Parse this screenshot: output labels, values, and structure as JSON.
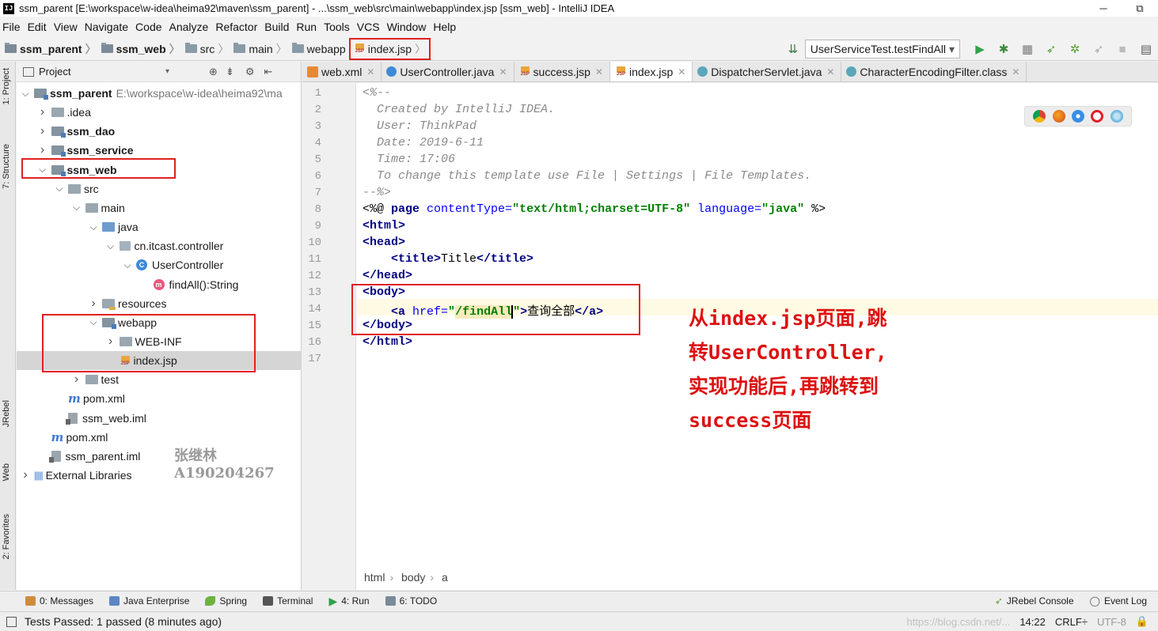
{
  "window": {
    "title": "ssm_parent [E:\\workspace\\w-idea\\heima92\\maven\\ssm_parent] - ...\\ssm_web\\src\\main\\webapp\\index.jsp [ssm_web] - IntelliJ IDEA",
    "app_icon": "IJ",
    "minimize": "─",
    "maximize": "⧉"
  },
  "menu": [
    "File",
    "Edit",
    "View",
    "Navigate",
    "Code",
    "Analyze",
    "Refactor",
    "Build",
    "Run",
    "Tools",
    "VCS",
    "Window",
    "Help"
  ],
  "nav_breadcrumb": [
    "ssm_parent",
    "ssm_web",
    "src",
    "main",
    "webapp",
    "index.jsp"
  ],
  "run_config": "UserServiceTest.testFindAll",
  "left_strip_tabs": [
    "1: Project",
    "7: Structure",
    "JRebel",
    "Web",
    "2: Favorites"
  ],
  "project_panel": {
    "title": "Project",
    "tree": [
      {
        "label": "ssm_parent",
        "extra": "E:\\workspace\\w-idea\\heima92\\ma",
        "depth": 0,
        "arrow": "v",
        "icon": "module-folder",
        "bold": true
      },
      {
        "label": ".idea",
        "depth": 1,
        "arrow": ">",
        "icon": "folder"
      },
      {
        "label": "ssm_dao",
        "depth": 1,
        "arrow": ">",
        "icon": "module-folder",
        "bold": true
      },
      {
        "label": "ssm_service",
        "depth": 1,
        "arrow": ">",
        "icon": "module-folder",
        "bold": true
      },
      {
        "label": "ssm_web",
        "depth": 1,
        "arrow": "v",
        "icon": "module-folder",
        "bold": true
      },
      {
        "label": "src",
        "depth": 2,
        "arrow": "v",
        "icon": "folder"
      },
      {
        "label": "main",
        "depth": 3,
        "arrow": "v",
        "icon": "folder"
      },
      {
        "label": "java",
        "depth": 4,
        "arrow": "v",
        "icon": "source-folder"
      },
      {
        "label": "cn.itcast.controller",
        "depth": 5,
        "arrow": "v",
        "icon": "package"
      },
      {
        "label": "UserController",
        "depth": 6,
        "arrow": "v",
        "icon": "class"
      },
      {
        "label": "findAll():String",
        "depth": 7,
        "arrow": "",
        "icon": "method"
      },
      {
        "label": "resources",
        "depth": 4,
        "arrow": ">",
        "icon": "resource-folder"
      },
      {
        "label": "webapp",
        "depth": 4,
        "arrow": "v",
        "icon": "web-folder"
      },
      {
        "label": "WEB-INF",
        "depth": 5,
        "arrow": ">",
        "icon": "folder"
      },
      {
        "label": "index.jsp",
        "depth": 5,
        "arrow": "",
        "icon": "jsp-file",
        "selected": true
      },
      {
        "label": "test",
        "depth": 3,
        "arrow": ">",
        "icon": "folder"
      },
      {
        "label": "pom.xml",
        "depth": 2,
        "arrow": "",
        "icon": "maven"
      },
      {
        "label": "ssm_web.iml",
        "depth": 2,
        "arrow": "",
        "icon": "iml-file"
      },
      {
        "label": "pom.xml",
        "depth": 1,
        "arrow": "",
        "icon": "maven"
      },
      {
        "label": "ssm_parent.iml",
        "depth": 1,
        "arrow": "",
        "icon": "iml-file"
      },
      {
        "label": "External Libraries",
        "depth": 0,
        "arrow": ">",
        "icon": "library"
      }
    ]
  },
  "watermark": {
    "line1": "张继林",
    "line2": "A190204267"
  },
  "editor_tabs": [
    {
      "label": "web.xml",
      "icon": "xml"
    },
    {
      "label": "UserController.java",
      "icon": "java"
    },
    {
      "label": "success.jsp",
      "icon": "jsp"
    },
    {
      "label": "index.jsp",
      "icon": "jsp",
      "active": true
    },
    {
      "label": "DispatcherServlet.java",
      "icon": "cls"
    },
    {
      "label": "CharacterEncodingFilter.class",
      "icon": "cls"
    }
  ],
  "code": {
    "line_numbers": [
      "1",
      "2",
      "3",
      "4",
      "5",
      "6",
      "7",
      "8",
      "9",
      "10",
      "11",
      "12",
      "13",
      "14",
      "15",
      "16",
      "17"
    ],
    "comment_lines": [
      "<%--",
      "  Created by IntelliJ IDEA.",
      "  User: ThinkPad",
      "  Date: 2019-6-11",
      "  Time: 17:06",
      "  To change this template use File | Settings | File Templates.",
      "--%>"
    ],
    "l8": {
      "open": "<%@ ",
      "kw": "page",
      "a1": " contentType=",
      "v1": "\"text/html;charset=UTF-8\"",
      "a2": " language=",
      "v2": "\"java\"",
      "close": " %>"
    },
    "l9": "<html>",
    "l10": "<head>",
    "l11": {
      "indent": "    ",
      "open": "<title>",
      "text": "Title",
      "close": "</title>"
    },
    "l12": "</head>",
    "l13": "<body>",
    "l14": {
      "indent": "    ",
      "open": "<a",
      "attr": " href=",
      "q1": "\"",
      "val": "/findAll",
      "q2": "\"",
      "gt": ">",
      "text": "查询全部",
      "close": "</a>"
    },
    "l15": "</body>",
    "l16": "</html>"
  },
  "annotation": [
    "从index.jsp页面,跳",
    "转UserController,",
    "实现功能后,再跳转到",
    "success页面"
  ],
  "editor_breadcrumb": [
    "html",
    "body",
    "a"
  ],
  "bottom_tools": [
    {
      "label": "0: Messages",
      "color": "#d08c3c"
    },
    {
      "label": "Java Enterprise",
      "color": "#5b87c5"
    },
    {
      "label": "Spring",
      "color": "#6db33f"
    },
    {
      "label": "Terminal",
      "color": "#555555"
    },
    {
      "label": "4: Run",
      "color": "#2fa24a"
    },
    {
      "label": "6: TODO",
      "color": "#7a8a99"
    }
  ],
  "bottom_right_tools": [
    "JRebel Console",
    "Event Log"
  ],
  "status": {
    "message": "Tests Passed: 1 passed (8 minutes ago)",
    "time": "14:22",
    "line_sep": "CRLF÷",
    "encoding": "UTF-8",
    "overlay_url": "https://blog.csdn.net/..."
  },
  "colors": {
    "highlight_red": "#e02020",
    "annotation_red": "#dd1111"
  }
}
